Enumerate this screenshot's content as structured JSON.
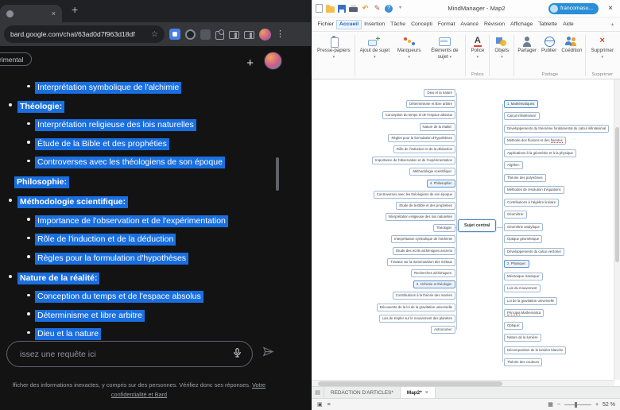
{
  "icons": {
    "close": "×",
    "new_tab": "+",
    "star": "☆",
    "kebab": "⋮",
    "plus": "+",
    "dropdown_arrow": "▾",
    "undo": "↶",
    "pen": "✎",
    "help": "?",
    "chevron_collapse": "▴",
    "sheet_icon": "▤",
    "status_icon_1": "▣",
    "status_icon_2": "≡",
    "view_icon": "▦",
    "zoom_out": "−",
    "zoom_in": "+",
    "ribbon_glyphs": {
      "add-topic": "+",
      "font": "A",
      "delete": "×"
    }
  },
  "browser": {
    "url": "bard.google.com/chat/63ad0d7f963d18df",
    "badge": "rimental",
    "input_placeholder": "issez une requête ici",
    "footer_text": "fficher des informations inexactes, y compris sur des personnes. Vérifiez donc ses réponses.",
    "footer_link": "Votre confidentialité et Bard",
    "list": [
      {
        "text": "Interprétation symbolique de l'alchimie",
        "level": 2
      },
      {
        "text": "Théologie:",
        "level": 1,
        "bold": true
      },
      {
        "text": "Interprétation religieuse des lois naturelles",
        "level": 2
      },
      {
        "text": "Étude de la Bible et des prophéties",
        "level": 2
      },
      {
        "text": "Controverses avec les théologiens de son époque",
        "level": 2
      },
      {
        "text": "Philosophie:",
        "level": 0,
        "bold": true,
        "gap": true
      },
      {
        "text": "Méthodologie scientifique:",
        "level": 1,
        "bold": true,
        "gap": true
      },
      {
        "text": "Importance de l'observation et de l'expérimentation",
        "level": 2
      },
      {
        "text": "Rôle de l'induction et de la déduction",
        "level": 2
      },
      {
        "text": "Règles pour la formulation d'hypothèses",
        "level": 2
      },
      {
        "text": "Nature de la réalité:",
        "level": 1,
        "bold": true,
        "gap": true
      },
      {
        "text": "Conception du temps et de l'espace absolus",
        "level": 2
      },
      {
        "text": "Déterminisme et libre arbitre",
        "level": 2
      },
      {
        "text": "Dieu et la nature",
        "level": 2
      }
    ]
  },
  "mindmanager": {
    "title": "MindManager - Map2",
    "account": "francomasu...",
    "active_menu": "Accueil",
    "menu": [
      "Fichier",
      "Accueil",
      "Insertion",
      "Tâche",
      "Concepti",
      "Format",
      "Avancé",
      "Révision",
      "Affichage",
      "Tablette",
      "Aide"
    ],
    "ribbon_groups": [
      {
        "label": "",
        "buttons": [
          {
            "label": "Presse-papiers",
            "icon": "clipboard",
            "arrow": true
          }
        ]
      },
      {
        "label": "",
        "buttons": [
          {
            "label": "Ajout de sujet",
            "icon": "add-topic",
            "arrow": true
          },
          {
            "label": "Marqueurs",
            "icon": "markers",
            "arrow": true
          },
          {
            "label": "Éléments de sujet",
            "icon": "topic-elements",
            "arrow": true
          }
        ]
      },
      {
        "label": "Police",
        "buttons": [
          {
            "label": "Police",
            "icon": "font",
            "arrow": true
          }
        ]
      },
      {
        "label": "",
        "buttons": [
          {
            "label": "Objets",
            "icon": "objects",
            "arrow": true
          }
        ]
      },
      {
        "label": "Partage",
        "buttons": [
          {
            "label": "Partager",
            "icon": "share"
          },
          {
            "label": "Publier",
            "icon": "publish"
          },
          {
            "label": "Coédition",
            "icon": "coedit"
          }
        ]
      },
      {
        "label": "Supprimer",
        "buttons": [
          {
            "label": "Supprimer",
            "icon": "delete",
            "arrow": true
          }
        ]
      }
    ],
    "central": "Sujet central",
    "left_nodes": [
      "Dieu et la nature",
      "Déterminisme et libre arbitre",
      "Conception du temps et de l'espace absolus",
      "Nature de la réalité:",
      "Règles pour la formulation d'hypothèses",
      "Rôle de l'induction et de la déduction",
      "Importance de l'observation et de l'expérimentation",
      "Méthodologie scientifique:",
      {
        "text": "4. Philosophie:",
        "main": true
      },
      "Controverses avec les théologiens de son époque",
      "Étude de la Bible et des prophéties",
      "Interprétation religieuse des lois naturelles",
      "Théologie:",
      "Interprétation symbolique de l'alchimie",
      "Étude des écrits alchimiques anciens",
      "Travaux sur la transmutation des métaux",
      "Recherches alchimiques:",
      {
        "text": "3. Alchimie et théologie:",
        "main": true
      },
      "Contributions à la théorie des marées",
      "Découverte de la loi de la gravitation universelle",
      "Lois de Kepler sur le mouvement des planètes",
      "Astronomie:"
    ],
    "right_nodes": [
      {
        "text": "1. Mathématiques:",
        "main": true
      },
      "Calcul infinitésimal:",
      "Développements du théorème fondamental du calcul infinitésimal",
      {
        "pre": "Méthode des fluxions et des ",
        "mark": "fluentes",
        "post": ""
      },
      "Applications à la géométrie et à la physique",
      "Algèbre:",
      "Théorie des polynômes",
      "Méthodes de résolution d'équations",
      "Contributions à l'algèbre linéaire",
      "Géométrie:",
      "Géométrie analytique",
      "Optique géométrique",
      "Développements du calcul vectoriel",
      {
        "text": "2. Physique:",
        "main": true
      },
      "Mécanique classique:",
      "Lois du mouvement",
      "Loi de la gravitation universelle",
      {
        "pre": "",
        "mark": "Principia",
        "post": " Mathematica"
      },
      "Optique:",
      "Nature de la lumière",
      "Décomposition de la lumière blanche",
      "Théorie des couleurs"
    ],
    "sheet_tabs": [
      "REDACTION D'ARTICLES*",
      "Map2*"
    ],
    "status": {
      "zoom": "52 %"
    }
  }
}
